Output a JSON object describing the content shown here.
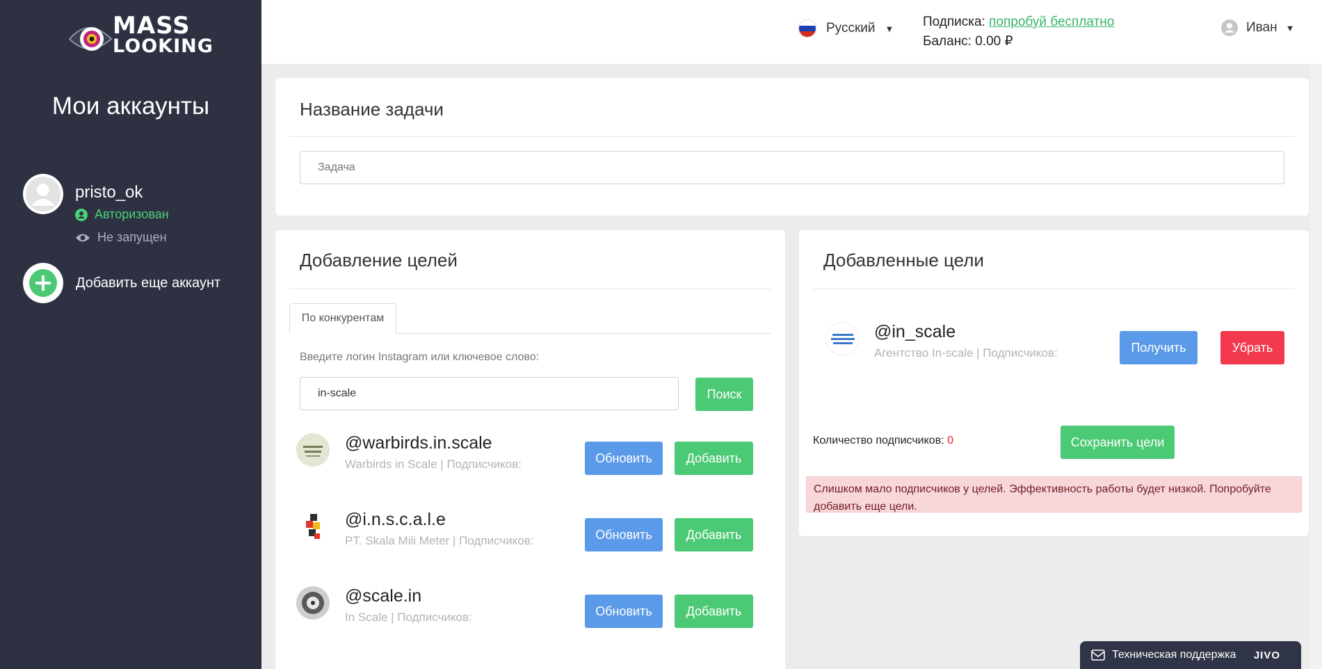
{
  "brand": {
    "line1": "MASS",
    "line2": "LOOKING"
  },
  "sidebar": {
    "title": "Мои аккаунты",
    "account": {
      "name": "pristo_ok",
      "auth_status": "Авторизован",
      "run_status": "Не запущен"
    },
    "add_account_label": "Добавить еще аккаунт"
  },
  "header": {
    "language": "Русский",
    "subscription_label": "Подписка:",
    "subscription_link": "попробуй бесплатно",
    "balance": "Баланс: 0.00 ₽",
    "user_name": "Иван"
  },
  "task": {
    "title": "Название задачи",
    "input_placeholder": "Задача"
  },
  "add_targets": {
    "title": "Добавление целей",
    "tab": "По конкурентам",
    "prompt": "Введите логин Instagram или ключевое слово:",
    "search_value": "in-scale",
    "search_button": "Поиск",
    "results": [
      {
        "handle": "@warbirds.in.scale",
        "desc": "Warbirds in Scale | Подписчиков:",
        "update": "Обновить",
        "add": "Добавить"
      },
      {
        "handle": "@i.n.s.c.a.l.e",
        "desc": "PT. Skala Mili Meter | Подписчиков:",
        "update": "Обновить",
        "add": "Добавить"
      },
      {
        "handle": "@scale.in",
        "desc": "In Scale | Подписчиков:",
        "update": "Обновить",
        "add": "Добавить"
      }
    ]
  },
  "added_targets": {
    "title": "Добавленные цели",
    "items": [
      {
        "handle": "@in_scale",
        "desc": "Агентство In-scale | Подписчиков:",
        "get": "Получить",
        "remove": "Убрать"
      }
    ],
    "followers_label": "Количество подписчиков:",
    "followers_count": "0",
    "save_button": "Сохранить цели",
    "warning": "Слишком мало подписчиков у целей. Эффективность работы будет низкой. Попробуйте добавить еще цели."
  },
  "support": {
    "label": "Техническая поддержка",
    "brand": "JIVO"
  },
  "colors": {
    "sidebar": "#2d3142",
    "green": "#4cc975",
    "blue": "#5b9ae8",
    "red": "#f2394d",
    "link": "#3bb36b"
  }
}
